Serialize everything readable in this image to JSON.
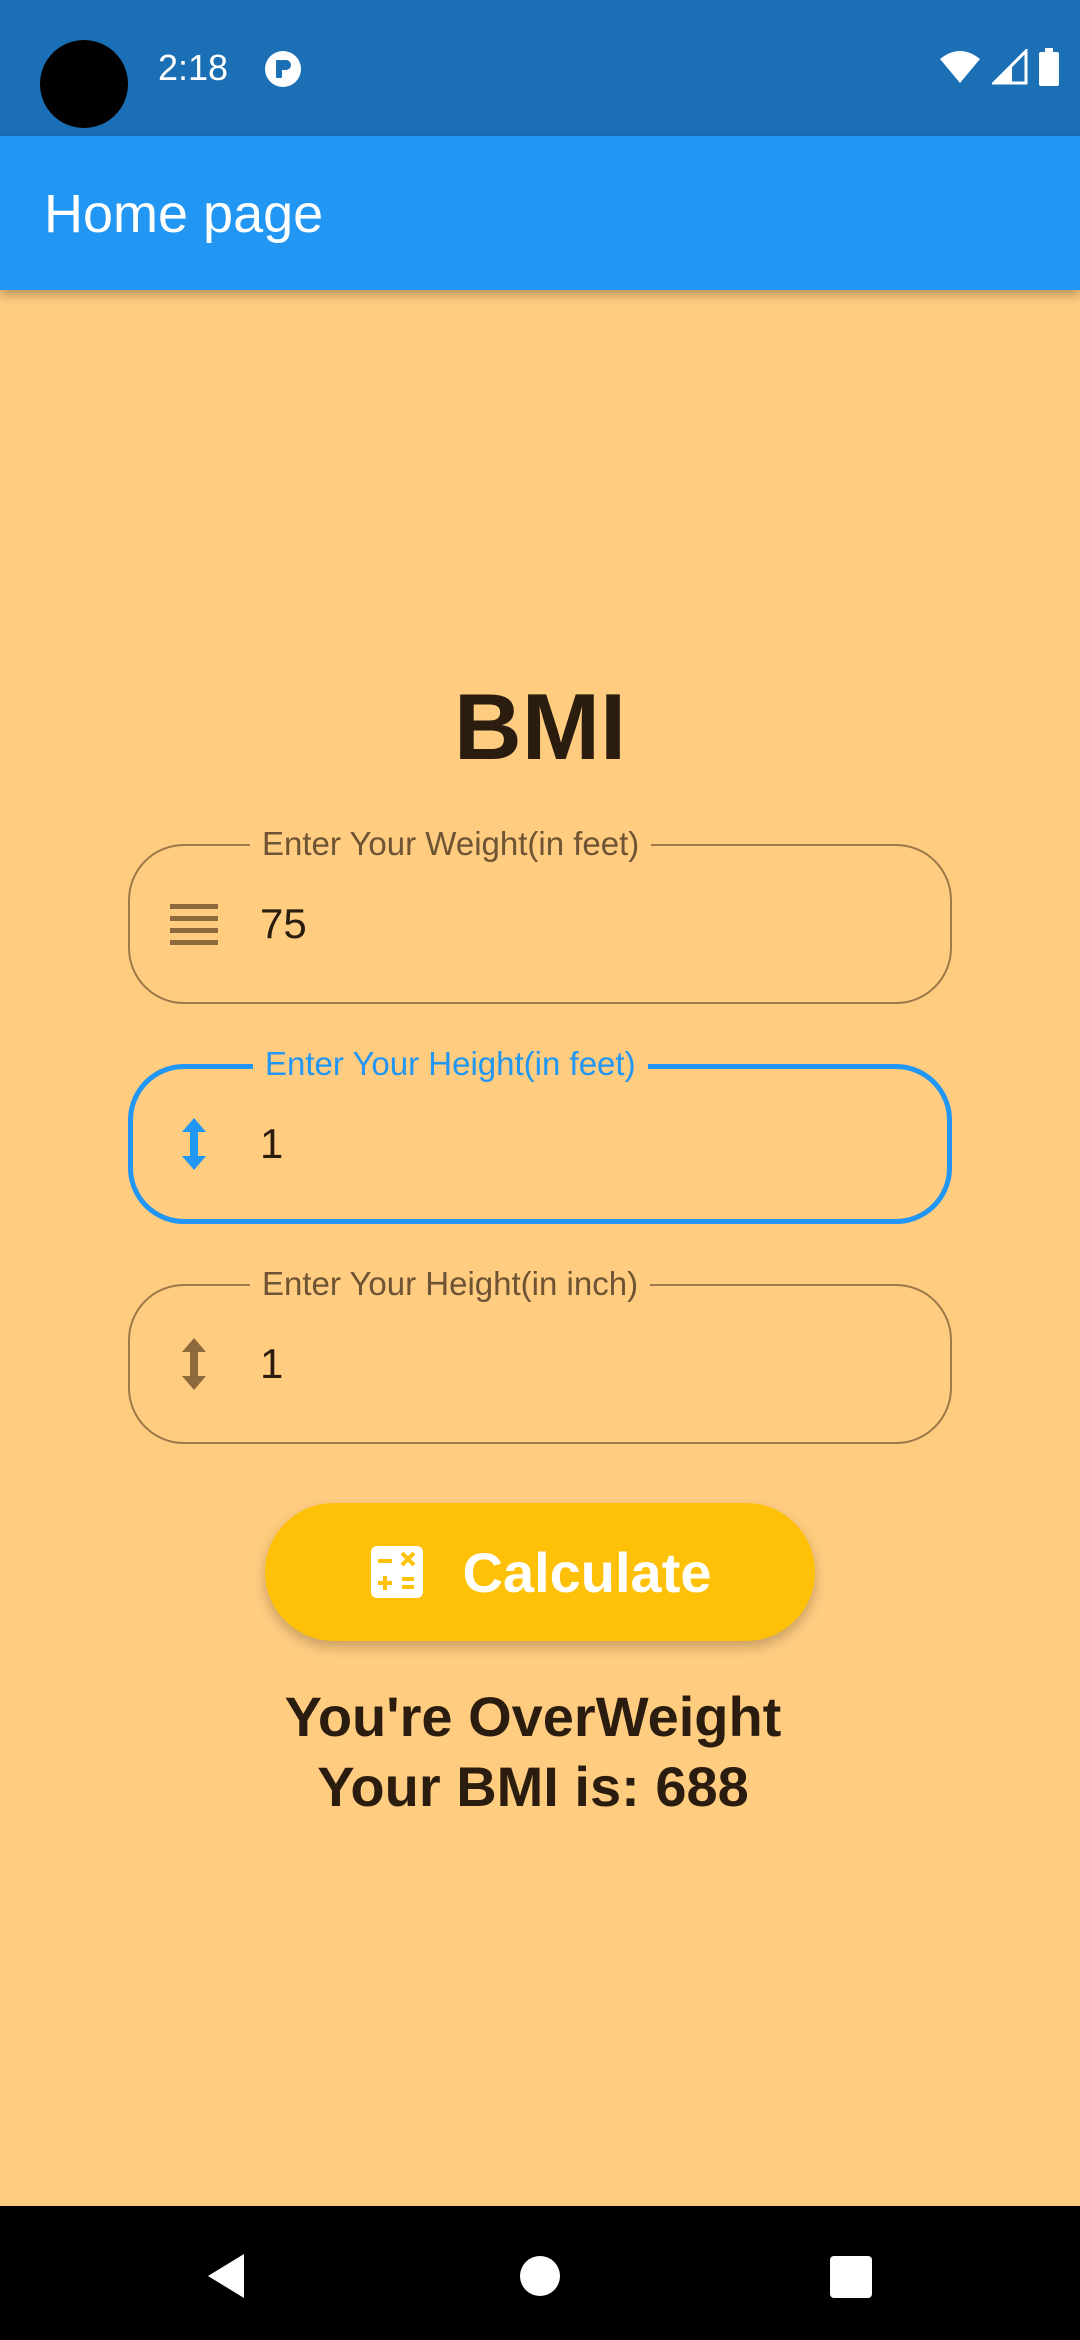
{
  "status_bar": {
    "time": "2:18",
    "icons": [
      "camera-cutout",
      "app-notification-icon",
      "wifi-icon",
      "cellular-signal-icon",
      "battery-icon"
    ]
  },
  "app_bar": {
    "title": "Home page",
    "color": "#2196F3"
  },
  "main": {
    "heading": "BMI",
    "background_color": "#FFCC80",
    "fields": [
      {
        "label": "Enter Your Weight(in feet)",
        "value": "75",
        "icon": "weight-lines-icon",
        "focused": false
      },
      {
        "label": "Enter Your Height(in feet)",
        "value": "1",
        "icon": "height-arrows-icon",
        "focused": true
      },
      {
        "label": "Enter Your Height(in inch)",
        "value": "1",
        "icon": "height-arrows-icon",
        "focused": false
      }
    ],
    "calculate_button": {
      "label": "Calculate",
      "icon": "calculator-icon",
      "color": "#FFC107"
    },
    "result": {
      "line1": "You're OverWeight",
      "line2": "Your BMI is: 688"
    }
  },
  "nav_bar": {
    "buttons": [
      "back-icon",
      "home-icon",
      "recents-icon"
    ]
  }
}
